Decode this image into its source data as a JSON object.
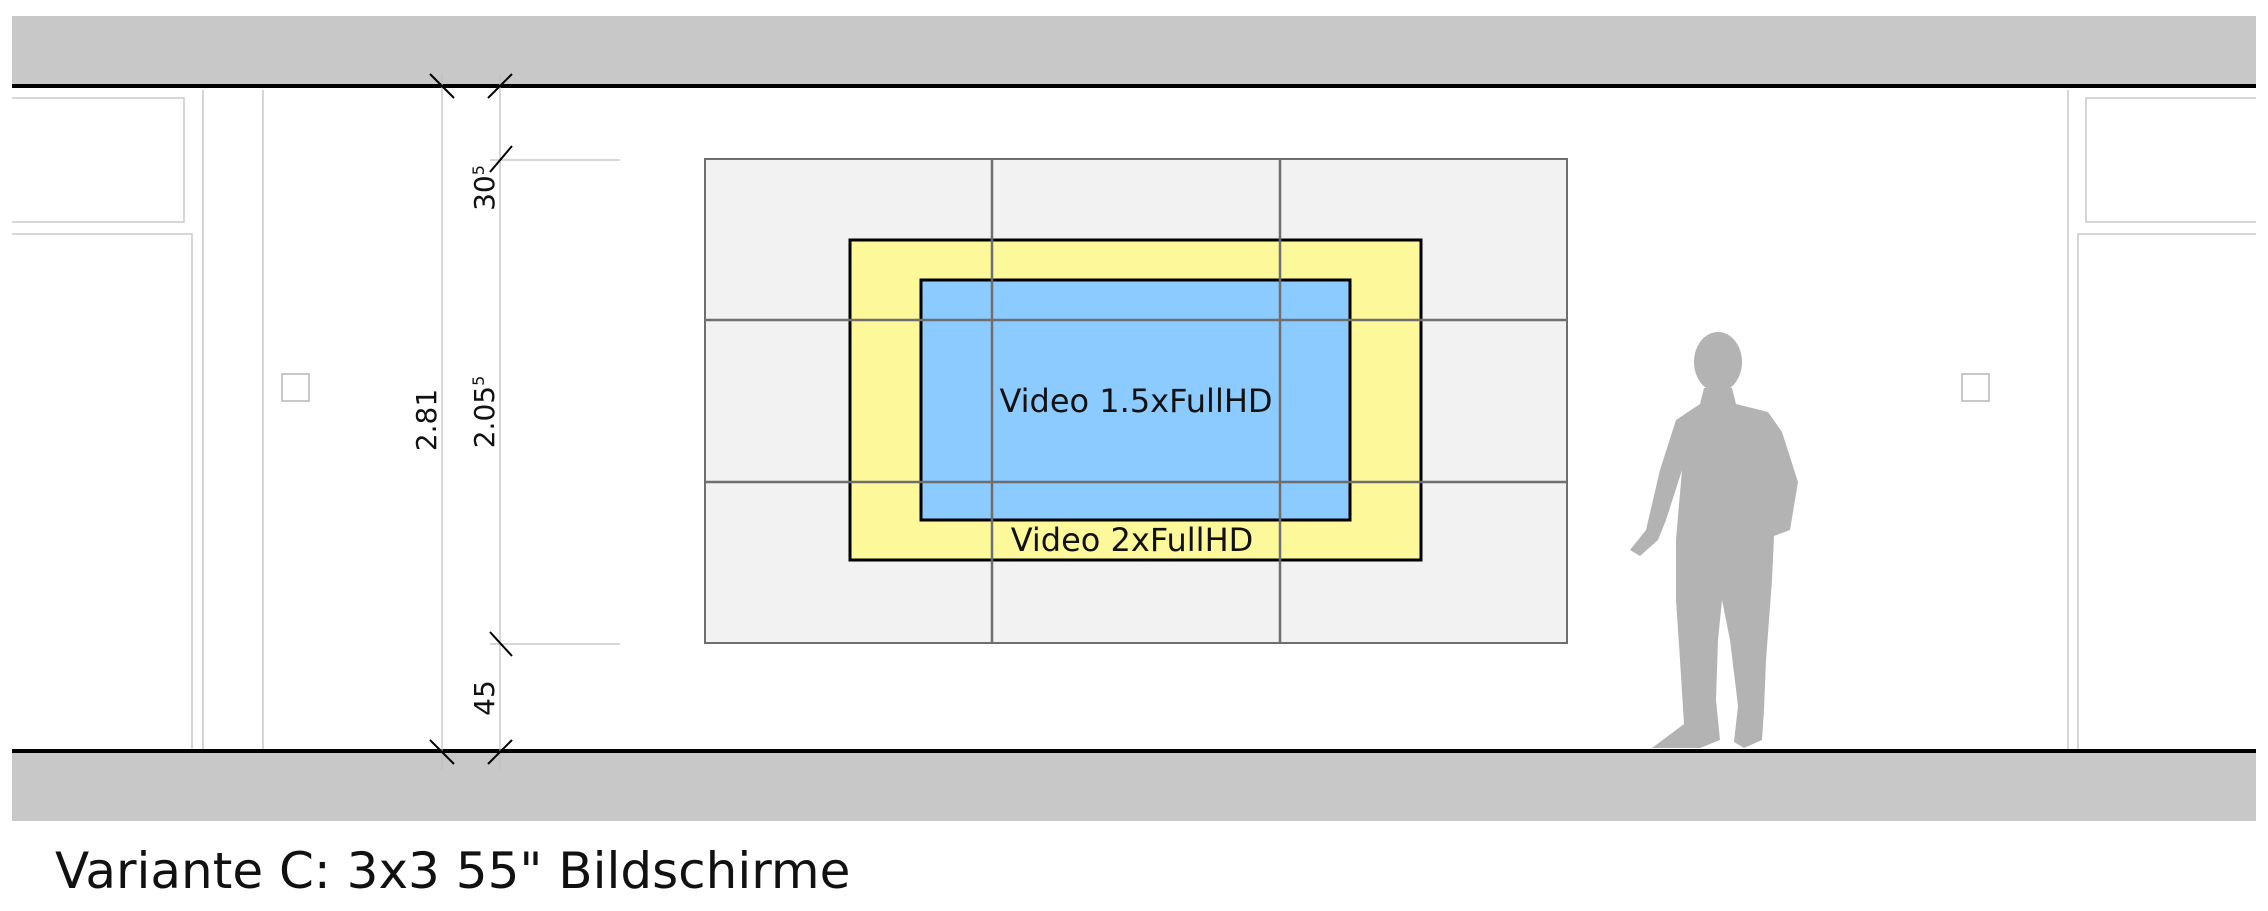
{
  "caption": "Variante C: 3x3 55\" Bildschirme",
  "video_wall": {
    "grid": "3x3",
    "outer_label": "Video 2xFullHD",
    "inner_label": "Video 1.5xFullHD"
  },
  "dimensions": {
    "total_height": {
      "main": "2.81",
      "sup": ""
    },
    "wall_height": {
      "main": "2.05",
      "sup": "5"
    },
    "top_gap": {
      "main": "30",
      "sup": "5"
    },
    "bottom_gap": {
      "main": "45",
      "sup": ""
    }
  },
  "colors": {
    "slab": "#c8c8c8",
    "screen": "#f2f2f2",
    "outer_video": "#fdf99a",
    "inner_video": "#8ccbff",
    "person": "#b3b3b3"
  }
}
